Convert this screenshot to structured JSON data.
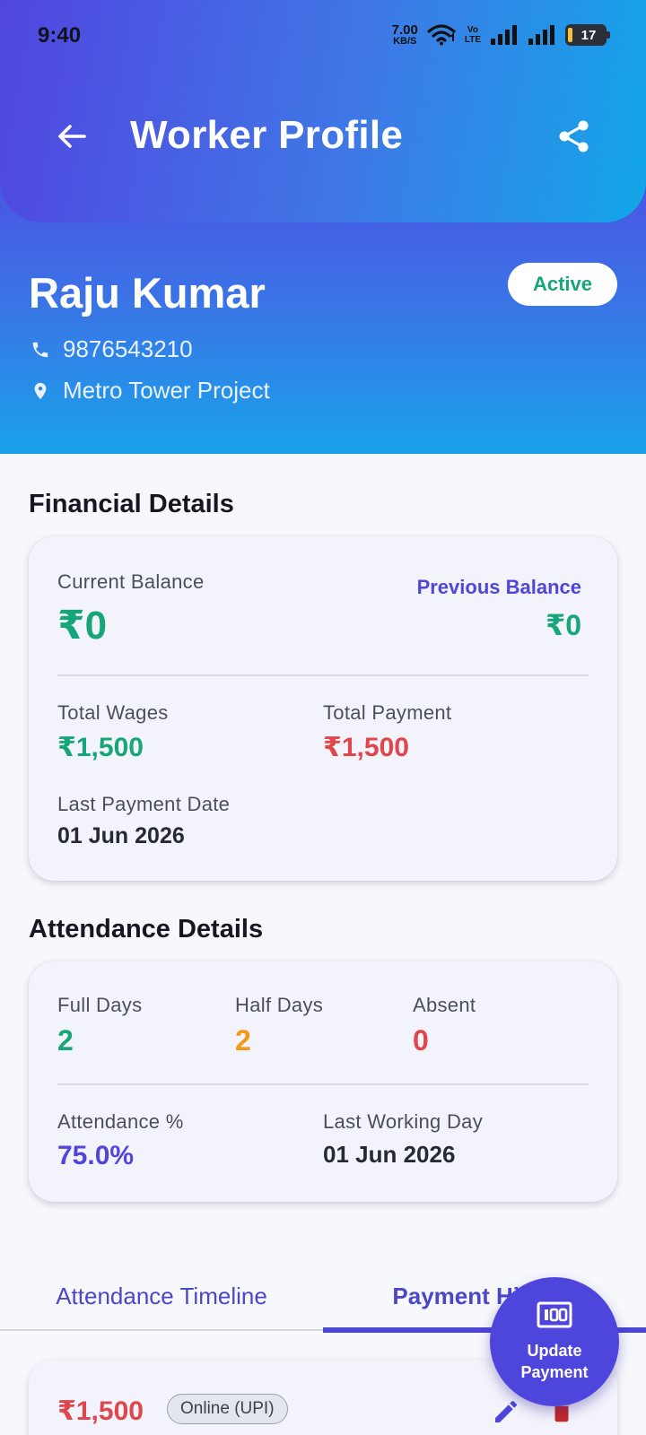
{
  "status_bar": {
    "time": "9:40",
    "net_speed_value": "7.00",
    "net_speed_unit": "KB/S",
    "volte_line1": "Vo",
    "volte_line2": "LTE",
    "battery": "17"
  },
  "header": {
    "title": "Worker Profile",
    "back_icon": "arrow-left-icon",
    "share_icon": "share-icon"
  },
  "profile": {
    "name": "Raju Kumar",
    "status": "Active",
    "phone": "9876543210",
    "site": "Metro Tower Project"
  },
  "financial": {
    "section_title": "Financial Details",
    "current_balance_label": "Current Balance",
    "current_balance_value": "₹0",
    "previous_balance_label": "Previous Balance",
    "previous_balance_value": "₹0",
    "total_wages_label": "Total Wages",
    "total_wages_value": "₹1,500",
    "total_payment_label": "Total Payment",
    "total_payment_value": "₹1,500",
    "last_payment_date_label": "Last Payment Date",
    "last_payment_date_value": "01 Jun 2026"
  },
  "attendance": {
    "section_title": "Attendance Details",
    "full_days_label": "Full Days",
    "full_days_value": "2",
    "half_days_label": "Half Days",
    "half_days_value": "2",
    "absent_label": "Absent",
    "absent_value": "0",
    "attendance_pct_label": "Attendance %",
    "attendance_pct_value": "75.0%",
    "last_working_day_label": "Last Working Day",
    "last_working_day_value": "01 Jun 2026"
  },
  "tabs": {
    "items": [
      {
        "label": "Attendance Timeline",
        "selected": false
      },
      {
        "label": "Payment History",
        "selected": true
      }
    ]
  },
  "payments": [
    {
      "amount": "₹1,500",
      "mode": "Online (UPI)"
    }
  ],
  "fab": {
    "label_line1": "Update",
    "label_line2": "Payment",
    "icon": "cash-icon"
  },
  "colors": {
    "primary": "#4e45dd",
    "positive": "#17a67a",
    "negative": "#e0474d",
    "warning": "#f29a14"
  }
}
